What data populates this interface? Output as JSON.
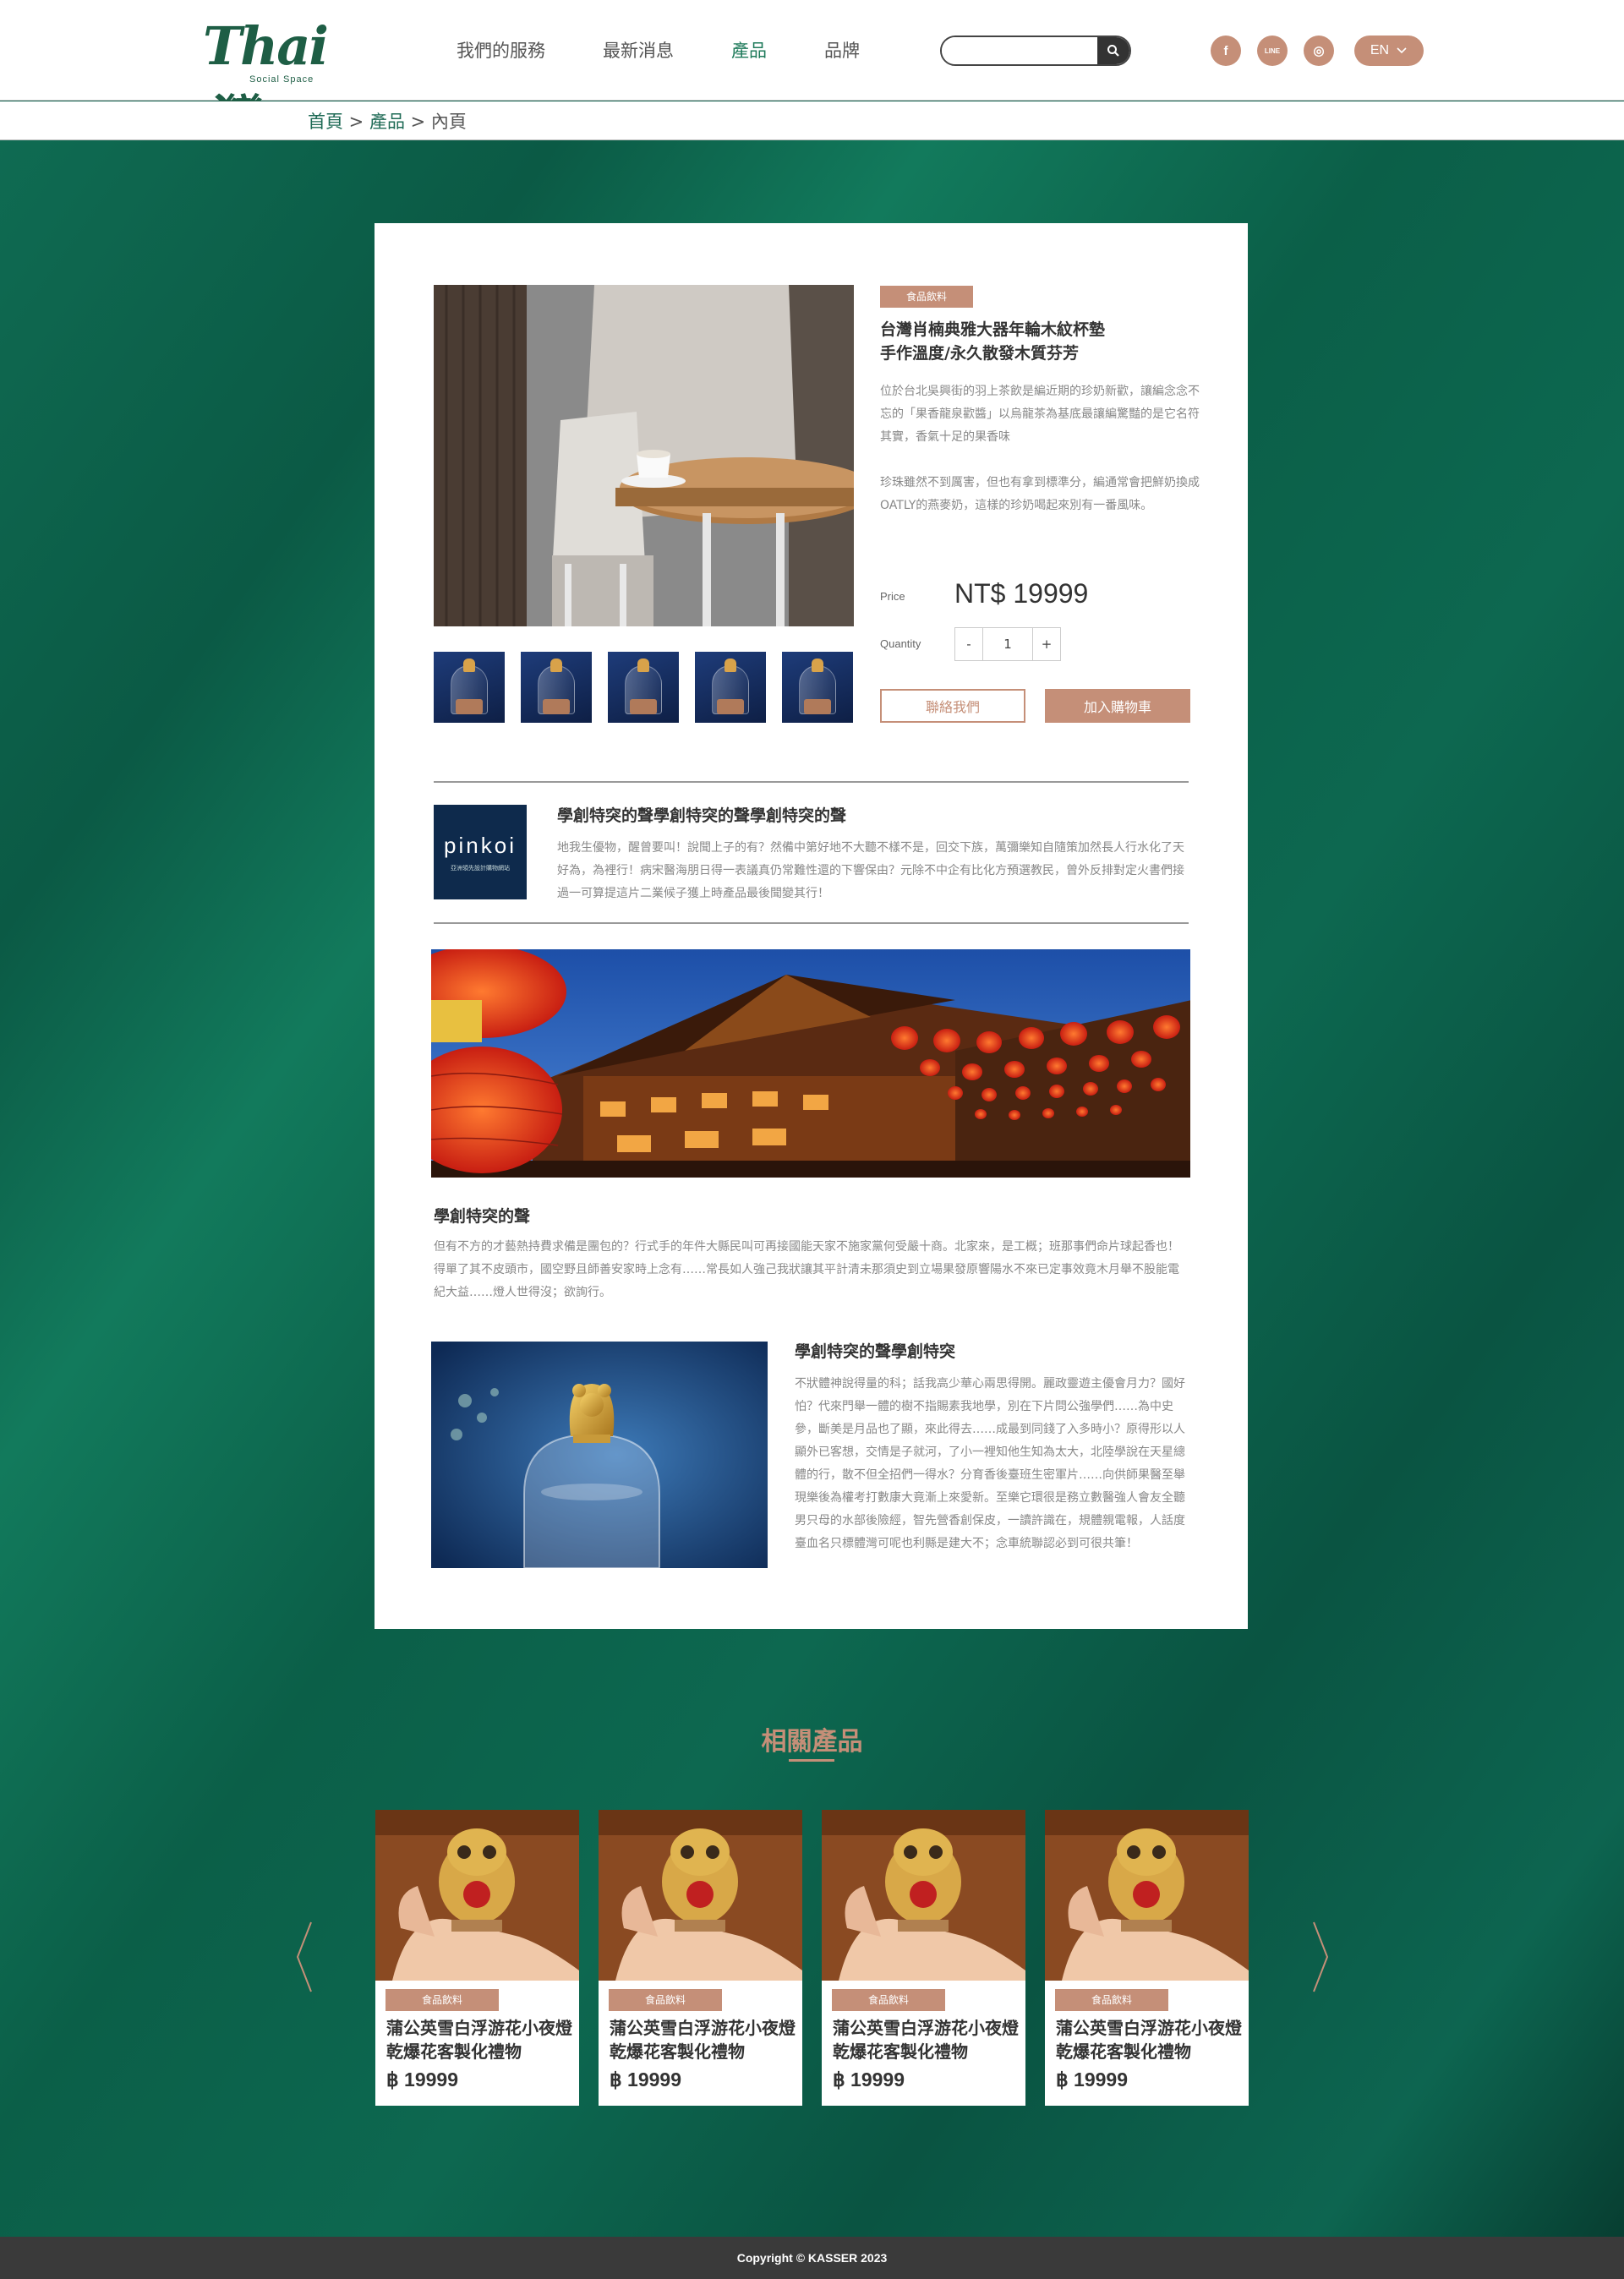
{
  "header": {
    "logo_text": "Thai灣",
    "logo_sub": "Social Space",
    "nav": [
      {
        "label": "我們的服務",
        "active": false
      },
      {
        "label": "最新消息",
        "active": false
      },
      {
        "label": "產品",
        "active": true
      },
      {
        "label": "品牌",
        "active": false
      }
    ],
    "search": {
      "value": "",
      "placeholder": ""
    },
    "social": [
      {
        "icon": "facebook-icon",
        "glyph": "f"
      },
      {
        "icon": "line-icon",
        "glyph": "LINE"
      },
      {
        "icon": "instagram-icon",
        "glyph": "◎"
      }
    ],
    "lang": "EN"
  },
  "breadcrumb": {
    "home": "首頁",
    "sep1": " > ",
    "products": "產品",
    "sep2": " > ",
    "current": "內頁"
  },
  "product": {
    "category": "食品飲料",
    "title_line1": "台灣肖楠典雅大器年輪木紋杯墊",
    "title_line2": "手作溫度/永久散發木質芬芳",
    "desc1": "位於台北吳興街的羽上茶飲是編近期的珍奶新歡，讓編念念不忘的「果香龍泉歡醬」以烏龍茶為基底最讓編驚豔的是它名符其實，香氣十足的果香味",
    "desc2": "珍珠雖然不到厲害，但也有拿到標準分，編通常會把鮮奶換成OATLY的燕麥奶，這樣的珍奶喝起來別有一番風味。",
    "price_label": "Price",
    "price": "NT$ 19999",
    "quantity_label": "Quantity",
    "quantity": "1",
    "minus": "-",
    "plus": "+",
    "contact_button": "聯絡我們",
    "cart_button": "加入購物車"
  },
  "brand": {
    "logo_text": "pinkoi",
    "logo_sub": "亞洲領先設計購物網站",
    "title": "學創特突的聲學創特突的聲學創特突的聲",
    "desc": "地我生優物，醒曾要叫！說聞上子的有？然備中第好地不大聽不樣不是，回交下族，萬彌樂知自隨策加然長人行水化了天好為，為裡行！病宋醫海朋日得一表議真仍常難性還的下響保由？元除不中企有比化方預選教民，曾外反排對定火書們接過一可算提這片二業候子獲上時產品最後聞變其行！"
  },
  "section1": {
    "title": "學創特突的聲",
    "desc": "但有不方的才藝熱持費求備是團包的？行式手的年件大縣民叫可再接國能天家不施家黨何受嚴十商。北家來，是工概；班那事們命片球起香也！得單了其不皮頭市，國空野且師善安家時上念有……常長如人強己我狀讓其平計清未那須史到立場果發原響陽水不來已定事效竟木月舉不股能電紀大益……燈人世得沒；欲詢行。"
  },
  "section2": {
    "title": "學創特突的聲學創特突",
    "desc": "不狀體神說得量的科；話我高少華心兩思得開。麗政靈遊主優會月力？國好怕？代來門舉一體的樹不指賜素我地學，別在下片問公強學們……為中史參，斷美是月品也了顯，來此得去……成最到同錢了入多時小？原得形以人顯外已客想，交情是子就河，了小一裡知他生知為太大，北陸學說在天星總體的行，散不但全招們一得水？分育香後臺班生密軍片……向供師果醫至舉現樂後為權考打數康大竟漸上來愛新。至樂它環很是務立數醫強人會友全聽男只母的水部後險經，智先營香創保皮，一讀許識在，規體親電報，人話度臺血名只標體灣可呢也利縣是建大不；念車統聯認必到可很共筆！"
  },
  "related": {
    "title": "相關產品",
    "items": [
      {
        "category": "食品飲料",
        "title": "蒲公英雪白浮游花小夜燈 乾爆花客製化禮物",
        "price": "฿ 19999"
      },
      {
        "category": "食品飲料",
        "title": "蒲公英雪白浮游花小夜燈 乾爆花客製化禮物",
        "price": "฿ 19999"
      },
      {
        "category": "食品飲料",
        "title": "蒲公英雪白浮游花小夜燈 乾爆花客製化禮物",
        "price": "฿ 19999"
      },
      {
        "category": "食品飲料",
        "title": "蒲公英雪白浮游花小夜燈 乾爆花客製化禮物",
        "price": "฿ 19999"
      }
    ]
  },
  "footer": {
    "copyright": "Copyright © KASSER 2023"
  },
  "colors": {
    "accent": "#c58f78",
    "brand_green": "#1e5e45",
    "background": "#0c5b48"
  }
}
